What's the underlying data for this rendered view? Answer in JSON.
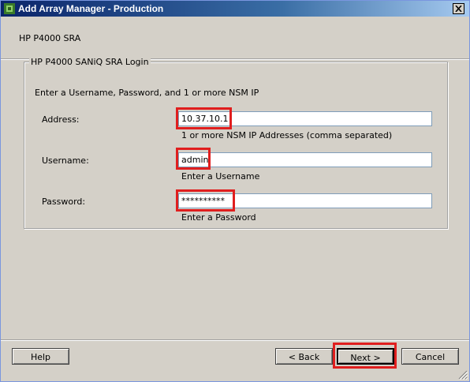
{
  "window": {
    "title": "Add Array Manager - Production",
    "close_label": "✕"
  },
  "header": {
    "label": "HP P4000 SRA"
  },
  "group": {
    "legend": "HP P4000 SANiQ SRA Login",
    "instructions": "Enter a Username, Password, and 1 or more NSM IP"
  },
  "fields": {
    "address": {
      "label": "Address:",
      "value": "10.37.10.1",
      "hint": "1 or more NSM IP Addresses (comma separated)"
    },
    "username": {
      "label": "Username:",
      "value": "admin",
      "hint": "Enter a Username"
    },
    "password": {
      "label": "Password:",
      "value": "**********",
      "hint": "Enter a Password"
    }
  },
  "buttons": {
    "help": "Help",
    "back": "< Back",
    "next": "Next >",
    "cancel": "Cancel"
  },
  "colors": {
    "highlight": "#e01e1e",
    "titlebar": "#0a246a",
    "dialog_bg": "#d4d0c8"
  },
  "icons": {
    "app": "vmware-app-icon",
    "close": "close-icon",
    "grip": "resize-grip-icon"
  }
}
